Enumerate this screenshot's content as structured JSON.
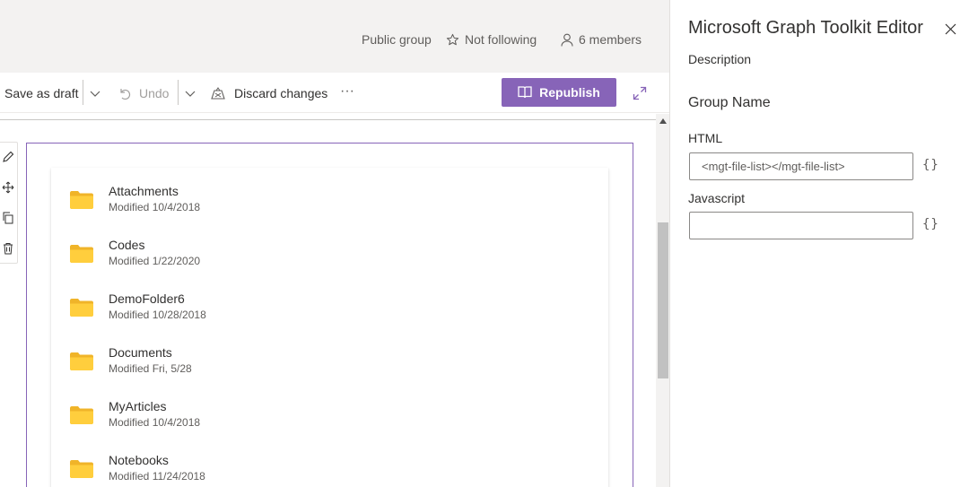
{
  "header": {
    "group_type": "Public group",
    "follow_label": "Not following",
    "members_label": "6 members"
  },
  "commandbar": {
    "save_draft": "Save as draft",
    "undo": "Undo",
    "discard": "Discard changes",
    "more": "···",
    "republish": "Republish"
  },
  "files": [
    {
      "name": "Attachments",
      "modified": "Modified 10/4/2018"
    },
    {
      "name": "Codes",
      "modified": "Modified 1/22/2020"
    },
    {
      "name": "DemoFolder6",
      "modified": "Modified 10/28/2018"
    },
    {
      "name": "Documents",
      "modified": "Modified Fri, 5/28"
    },
    {
      "name": "MyArticles",
      "modified": "Modified 10/4/2018"
    },
    {
      "name": "Notebooks",
      "modified": "Modified 11/24/2018"
    }
  ],
  "panel": {
    "title": "Microsoft Graph Toolkit Editor",
    "description": "Description",
    "group_name": "Group Name",
    "html_label": "HTML",
    "html_value": "<mgt-file-list></mgt-file-list>",
    "js_label": "Javascript",
    "js_value": "",
    "braces": "{}"
  },
  "colors": {
    "accent": "#8764b8",
    "folder": "#ffce3d",
    "header_bg": "#f3f2f1"
  },
  "scroll": {
    "visible_fraction": 0.42,
    "position_fraction": 0.29
  }
}
